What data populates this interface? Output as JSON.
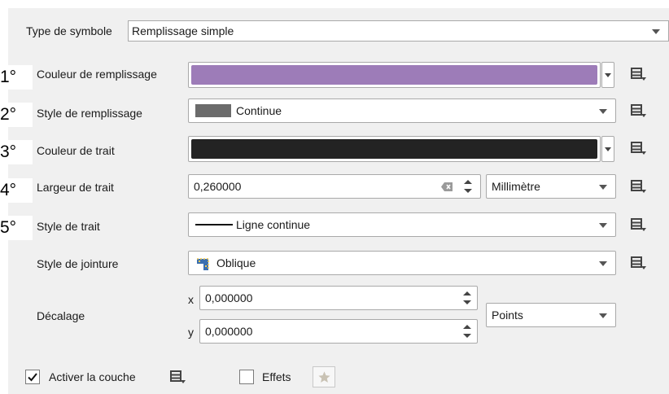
{
  "symbol_type": {
    "label": "Type de symbole",
    "value": "Remplissage simple"
  },
  "step_numbers": [
    "1°",
    "2°",
    "3°",
    "4°",
    "5°"
  ],
  "fill_color": {
    "label": "Couleur de remplissage",
    "color": "#9d7cb8"
  },
  "fill_style": {
    "label": "Style de remplissage",
    "value": "Continue",
    "swatch_color": "#6b6b6b"
  },
  "stroke_color": {
    "label": "Couleur de trait",
    "color": "#232323"
  },
  "stroke_width": {
    "label": "Largeur de trait",
    "value": "0,260000",
    "unit": "Millimètre"
  },
  "stroke_style": {
    "label": "Style de trait",
    "value": "Ligne continue"
  },
  "join_style": {
    "label": "Style de jointure",
    "value": "Oblique"
  },
  "offset": {
    "label": "Décalage",
    "x_label": "x",
    "x_value": "0,000000",
    "y_label": "y",
    "y_value": "0,000000",
    "unit": "Points"
  },
  "footer": {
    "enable_layer_label": "Activer la couche",
    "enable_layer_checked": true,
    "effects_label": "Effets",
    "effects_checked": false
  },
  "icons": {
    "data_defined": "data-defined-override-icon",
    "effects": "effects-star-icon"
  }
}
